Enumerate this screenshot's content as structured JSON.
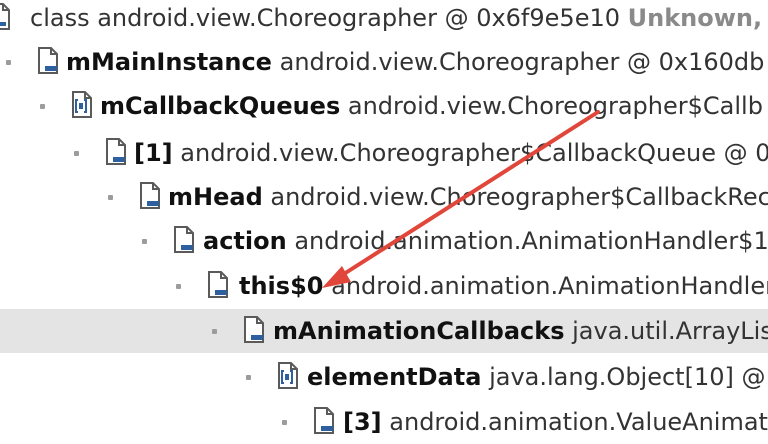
{
  "root": {
    "text": "class android.view.Choreographer @ 0x6f9e5e10",
    "extra": "Unknown,"
  },
  "rows": [
    {
      "name": "mMainInstance",
      "type": "android.view.Choreographer @ 0x160db",
      "icon": "object-field-icon"
    },
    {
      "name": "mCallbackQueues",
      "type": "android.view.Choreographer$Callb",
      "icon": "array-field-icon"
    },
    {
      "name": "[1]",
      "type": "android.view.Choreographer$CallbackQueue @ 0",
      "icon": "object-field-icon"
    },
    {
      "name": "mHead",
      "type": "android.view.Choreographer$CallbackRec",
      "icon": "object-field-icon"
    },
    {
      "name": "action",
      "type": "android.animation.AnimationHandler$1",
      "icon": "object-field-icon"
    },
    {
      "name": "this$0",
      "type": "android.animation.AnimationHandler",
      "icon": "object-field-icon"
    },
    {
      "name": "mAnimationCallbacks",
      "type": "java.util.ArrayLis",
      "icon": "object-field-icon",
      "selected": true
    },
    {
      "name": "elementData",
      "type": "java.lang.Object[10] @",
      "icon": "array-field-icon"
    },
    {
      "name": "[3]",
      "type": "android.animation.ValueAnimato",
      "icon": "object-field-icon"
    }
  ],
  "colors": {
    "selection": "#e4e4e4",
    "annotation_arrow": "#e0463a",
    "icon_accent": "#2e5f9e"
  }
}
